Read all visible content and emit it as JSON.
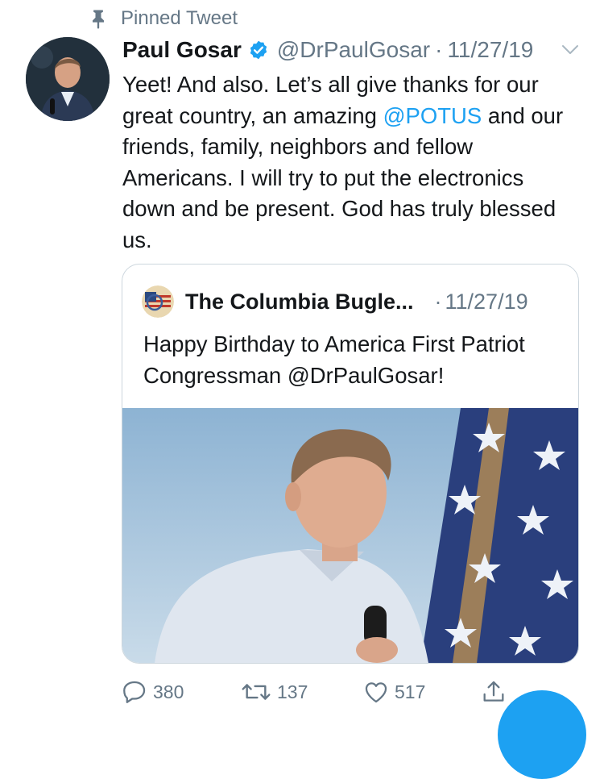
{
  "pinned_label": "Pinned Tweet",
  "tweet": {
    "author_name": "Paul Gosar",
    "handle": "@DrPaulGosar",
    "separator": "·",
    "date": "11/27/19",
    "text_before": "Yeet!  And also.  Let’s all give thanks for our great country, an amazing ",
    "mention": "@POTUS",
    "text_after": " and our friends, family, neighbors and fellow Americans.  I will try to put the electronics down and be present.  God has truly blessed us."
  },
  "quote": {
    "author_name": "The Columbia Bugle...",
    "separator": "·",
    "date": "11/27/19",
    "text": "Happy Birthday to America First Patriot Congressman @DrPaulGosar!"
  },
  "actions": {
    "replies": "380",
    "retweets": "137",
    "likes": "517"
  },
  "colors": {
    "accent": "#1da1f2",
    "secondary_text": "#657786",
    "border": "#ccd6dd"
  },
  "icons": [
    "pin-icon",
    "verified-badge-icon",
    "chevron-down-icon",
    "reply-icon",
    "retweet-icon",
    "like-icon",
    "share-icon"
  ]
}
